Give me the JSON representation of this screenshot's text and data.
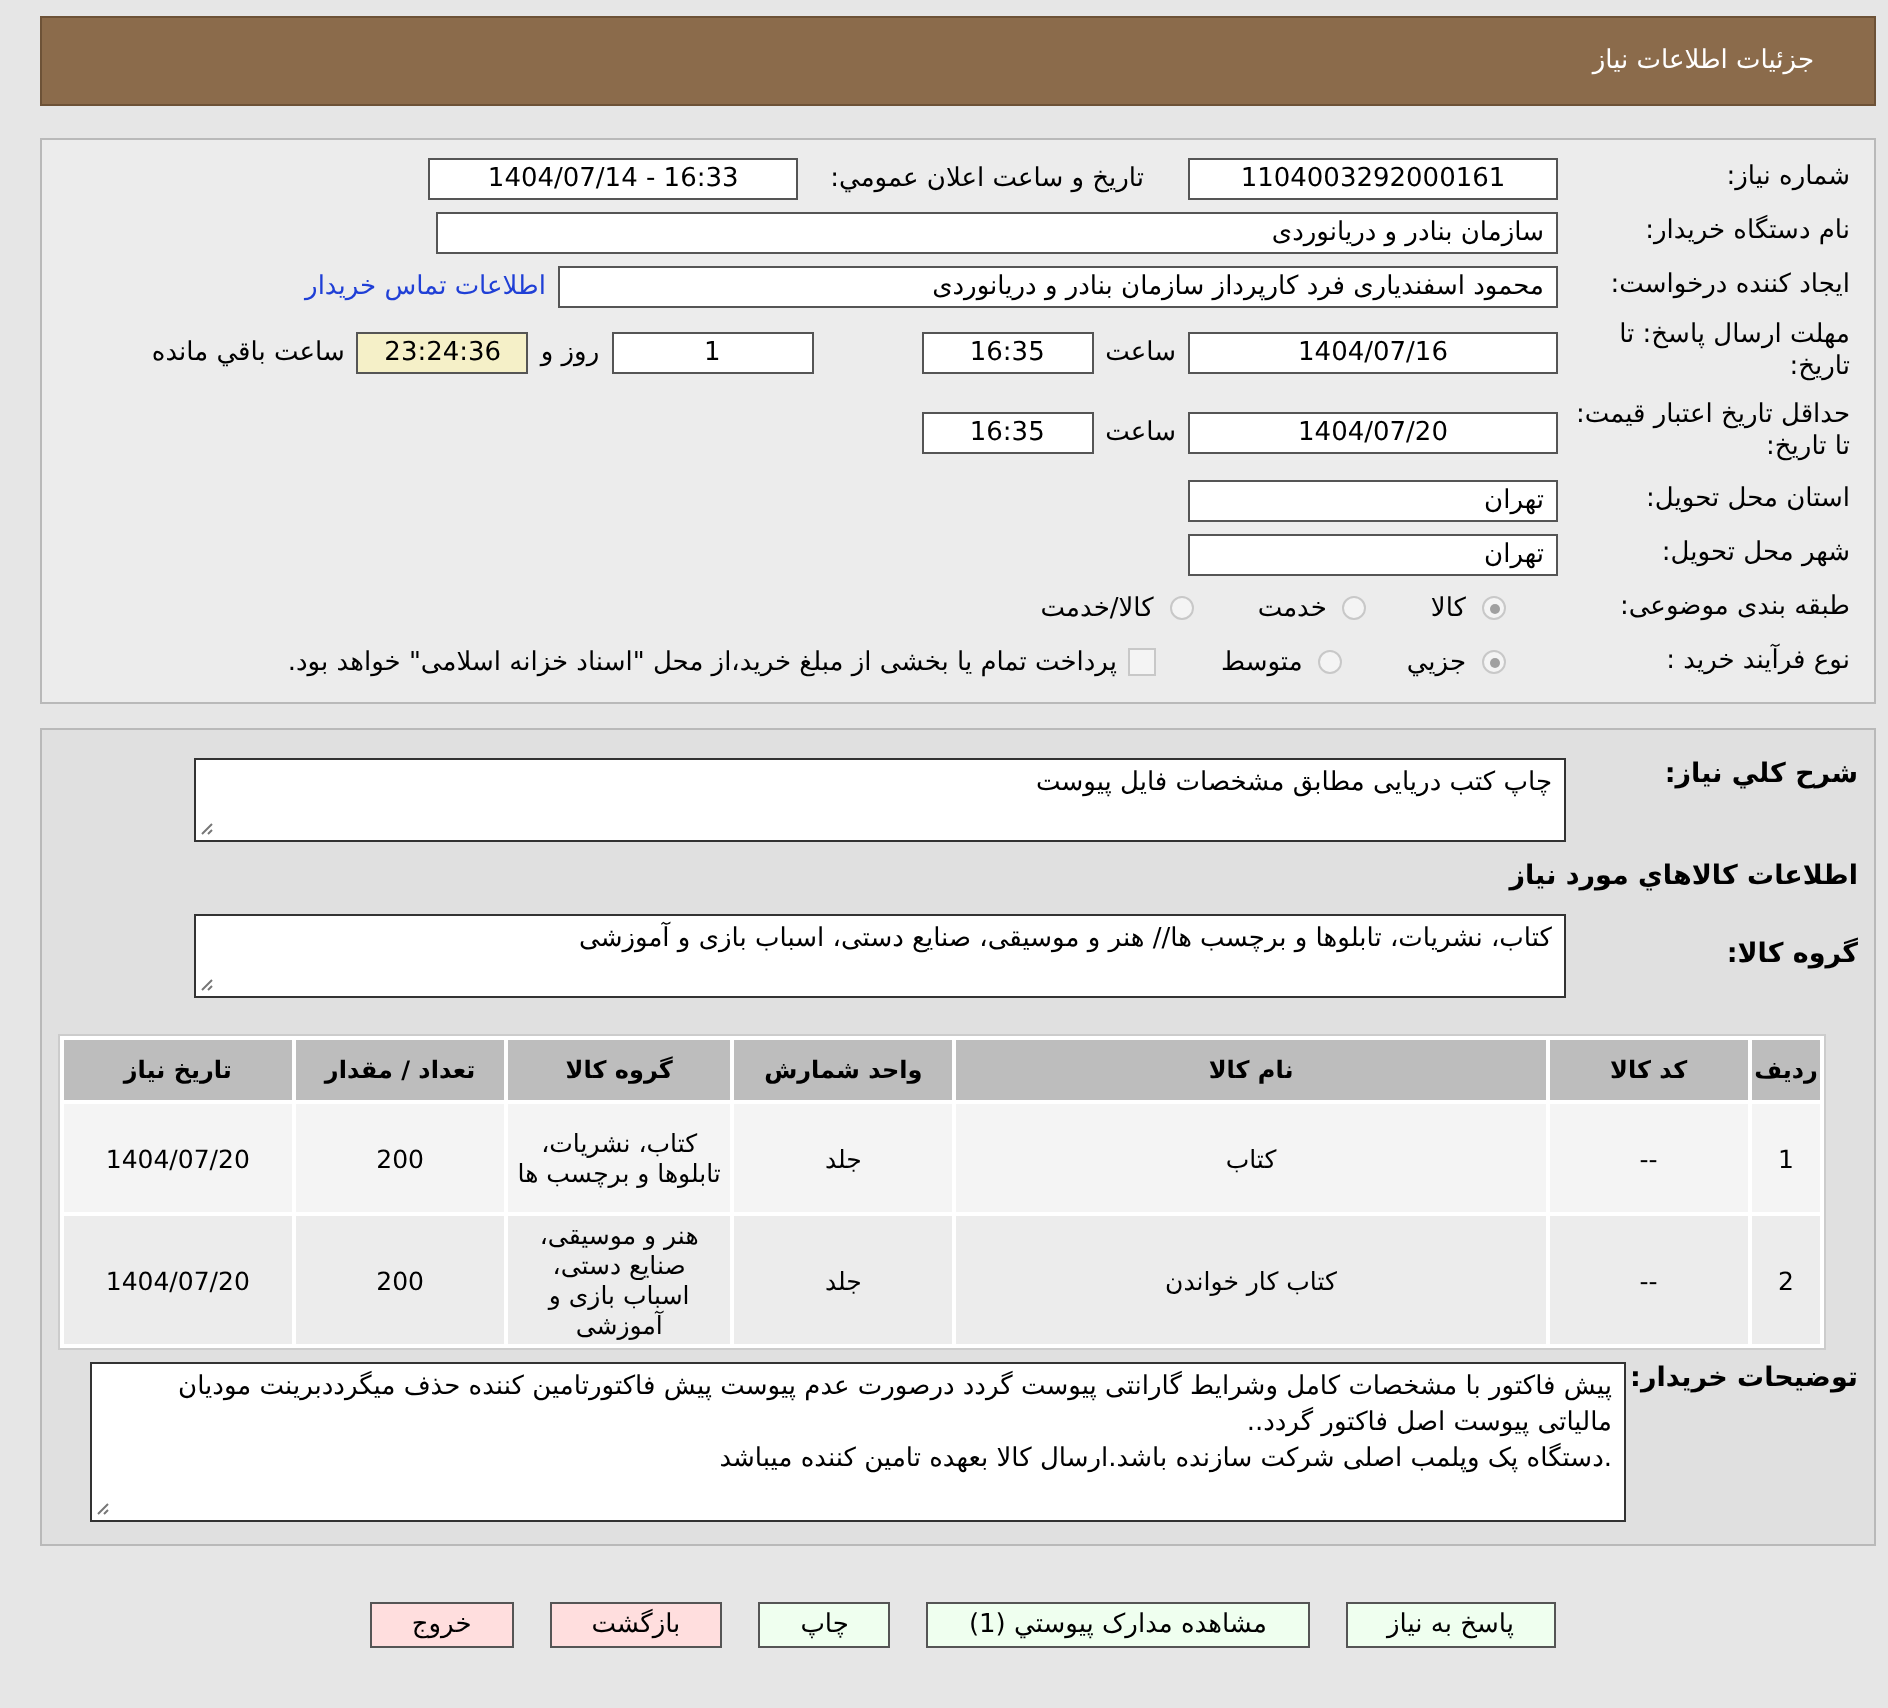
{
  "header": {
    "title": "جزئیات اطلاعات نیاز"
  },
  "need_number": {
    "label": "شماره نياز:",
    "value": "1104003292000161"
  },
  "announce": {
    "label": "تاريخ و ساعت اعلان عمومي:",
    "value": "1404/07/14 - 16:33"
  },
  "buyer_org": {
    "label": "نام دستگاه خريدار:",
    "value": "سازمان بنادر و دریانوردی"
  },
  "requester": {
    "label": "ايجاد کننده درخواست:",
    "value": "محمود اسفندیاری فرد کارپرداز سازمان بنادر و دریانوردی",
    "link": "اطلاعات تماس خريدار"
  },
  "deadline": {
    "label": "مهلت ارسال پاسخ: تا تاريخ:",
    "date": "1404/07/16",
    "time_label": "ساعت",
    "time": "16:35",
    "days": "1",
    "days_label": "روز و",
    "remaining": "23:24:36",
    "remaining_label": "ساعت باقي مانده"
  },
  "validity": {
    "label": "حداقل تاريخ اعتبار قيمت: تا تاريخ:",
    "date": "1404/07/20",
    "time_label": "ساعت",
    "time": "16:35"
  },
  "province": {
    "label": "استان محل تحويل:",
    "value": "تهران"
  },
  "city": {
    "label": "شهر محل تحويل:",
    "value": "تهران"
  },
  "category": {
    "label": "طبقه بندی موضوعی:",
    "options": [
      {
        "label": "کالا",
        "selected": true
      },
      {
        "label": "خدمت",
        "selected": false
      },
      {
        "label": "کالا/خدمت",
        "selected": false
      }
    ]
  },
  "process": {
    "label": "نوع فرآيند خريد :",
    "options": [
      {
        "label": "جزيي",
        "selected": true
      },
      {
        "label": "متوسط",
        "selected": false
      }
    ],
    "payment": {
      "label": "پرداخت تمام يا بخشی از مبلغ خريد،از محل \"اسناد خزانه اسلامی\" خواهد بود.",
      "checked": false
    }
  },
  "summary": {
    "label": "شرح کلي نياز:",
    "value": "چاپ کتب دریایی مطابق مشخصات فایل پیوست"
  },
  "goods_heading": "اطلاعات کالاهاي مورد نياز",
  "goods_group": {
    "label": "گروه کالا:",
    "value": "کتاب، نشریات، تابلوها و برچسب ها// هنر و موسیقی، صنایع دستی، اسباب بازی و آموزشی"
  },
  "table": {
    "columns": [
      "رديف",
      "کد کالا",
      "نام کالا",
      "واحد شمارش",
      "گروه کالا",
      "تعداد / مقدار",
      "تاريخ نياز"
    ],
    "rows": [
      [
        "1",
        "--",
        "کتاب",
        "جلد",
        "کتاب، نشریات، تابلوها و برچسب ها",
        "200",
        "1404/07/20"
      ],
      [
        "2",
        "--",
        "کتاب کار خواندن",
        "جلد",
        "هنر و موسیقی، صنایع دستی، اسباب بازی و آموزشی",
        "200",
        "1404/07/20"
      ]
    ]
  },
  "buyer_notes": {
    "label": "توضیحات خریدار:",
    "value": "پیش فاکتور با مشخصات کامل وشرایط گارانتی پیوست گردد درصورت عدم پیوست پیش فاکتورتامین کننده حذف میگرددبرینت مودیان مالیاتی پیوست اصل فاکتور گردد..\n.دستگاه پک وپلمب اصلی شرکت سازنده باشد.ارسال کالا بعهده تامین کننده میباشد"
  },
  "buttons": [
    {
      "label": "پاسخ به نياز",
      "kind": "action"
    },
    {
      "label": "مشاهده مدارک پيوستي (1)",
      "kind": "action"
    },
    {
      "label": "چاپ",
      "kind": "action"
    },
    {
      "label": "بازگشت",
      "kind": "exit"
    },
    {
      "label": "خروج",
      "kind": "exit"
    }
  ]
}
